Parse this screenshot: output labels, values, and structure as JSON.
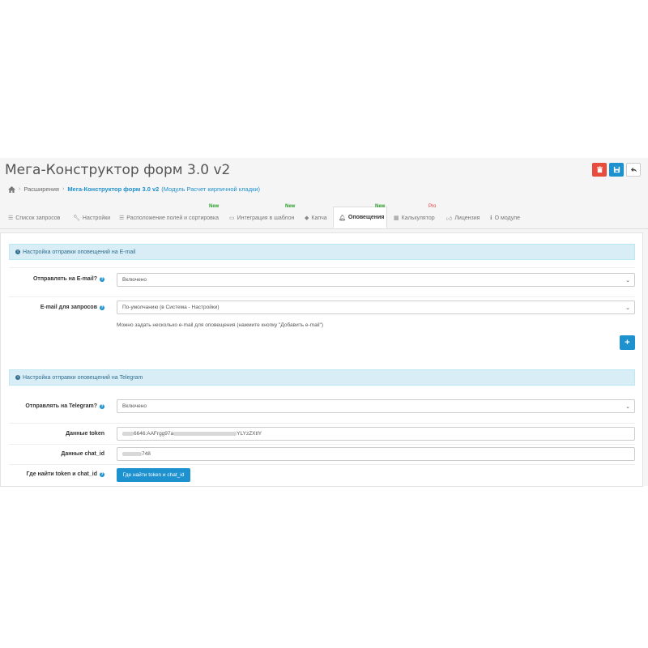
{
  "header": {
    "title": "Мега-Конструктор форм 3.0 v2",
    "delete_icon": "trash-icon",
    "save_icon": "save-icon",
    "back_icon": "reply-icon",
    "colors": {
      "delete": "#e74c3c",
      "save": "#1e91cf"
    }
  },
  "breadcrumb": {
    "home_icon": "home-icon",
    "items": [
      "Расширения",
      "Мега-Конструктор форм 3.0 v2"
    ],
    "module": "(Модуль Расчет кирпичной кладки)"
  },
  "tabs": [
    {
      "label": "Список запросов",
      "icon": "list-icon"
    },
    {
      "label": "Настройки",
      "icon": "wrench-icon"
    },
    {
      "label": "Расположение полей и сортировка",
      "icon": "list-icon",
      "badge": "New"
    },
    {
      "label": "Интеграция в шаблон",
      "icon": "desktop-icon",
      "badge": "New"
    },
    {
      "label": "Капча",
      "icon": "diamond-icon"
    },
    {
      "label": "Оповещения",
      "icon": "bell-icon",
      "badge": "New",
      "active": true
    },
    {
      "label": "Калькулятор",
      "icon": "calculator-icon",
      "badge": "Pro"
    },
    {
      "label": "Лицензия",
      "icon": "thumbs-up-icon"
    },
    {
      "label": "О модуле",
      "icon": "info-icon"
    }
  ],
  "email_section": {
    "title": "Настройка отправки оповещений на E-mail",
    "send_label": "Отправлять на E-mail?",
    "send_value": "Включено",
    "email_label": "E-mail для запросов",
    "email_value": "По-умолчанию (в Система - Настройки)",
    "hint": "Можно задать несколько e-mail для оповещения (нажмите кнопку \"Добавить e-mail\")",
    "add_button": "+"
  },
  "telegram_section": {
    "title": "Настройка отправки оповещений на Telegram",
    "send_label": "Отправлять на Telegram?",
    "send_value": "Включено",
    "token_label": "Данные token",
    "token_value_start": "6646:AAFrgg97a",
    "token_value_end": "YLYzZXtlY",
    "chat_label": "Данные chat_id",
    "chat_value_end": "748",
    "find_label": "Где найти token и chat_id",
    "find_button": "Где найти token и chat_id"
  }
}
